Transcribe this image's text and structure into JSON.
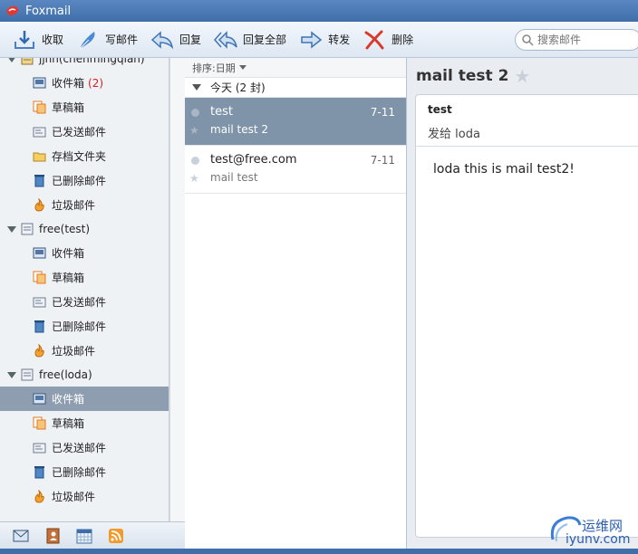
{
  "app": {
    "title": "Foxmail"
  },
  "toolbar": {
    "receive": "收取",
    "compose": "写邮件",
    "reply": "回复",
    "reply_all": "回复全部",
    "forward": "转发",
    "delete": "删除",
    "search_placeholder": "搜索邮件"
  },
  "sidebar": {
    "accounts": [
      {
        "name": "jjnn(chenmingqian)",
        "folders": [
          {
            "label": "收件箱",
            "count": "(2)"
          },
          {
            "label": "草稿箱"
          },
          {
            "label": "已发送邮件"
          },
          {
            "label": "存档文件夹"
          },
          {
            "label": "已删除邮件"
          },
          {
            "label": "垃圾邮件"
          }
        ]
      },
      {
        "name": "free(test)",
        "folders": [
          {
            "label": "收件箱"
          },
          {
            "label": "草稿箱"
          },
          {
            "label": "已发送邮件"
          },
          {
            "label": "已删除邮件"
          },
          {
            "label": "垃圾邮件"
          }
        ]
      },
      {
        "name": "free(loda)",
        "folders": [
          {
            "label": "收件箱"
          },
          {
            "label": "草稿箱"
          },
          {
            "label": "已发送邮件"
          },
          {
            "label": "已删除邮件"
          },
          {
            "label": "垃圾邮件"
          }
        ]
      }
    ]
  },
  "list": {
    "sort_label": "排序:日期",
    "group_label": "今天 (2 封)",
    "messages": [
      {
        "from": "test",
        "date": "7-11",
        "subject": "mail test 2"
      },
      {
        "from": "test@free.com",
        "date": "7-11",
        "subject": "mail test"
      }
    ]
  },
  "reader": {
    "subject": "mail test 2",
    "sender": "test",
    "to": "发给 loda",
    "body": "loda this is mail test2!"
  },
  "watermark": {
    "line1": "运维网",
    "line2": "iyunv.com"
  },
  "colors": {
    "title_bar": "#4a79b5",
    "selected_row": "#7f93a9",
    "unread_badge": "#d42020"
  }
}
